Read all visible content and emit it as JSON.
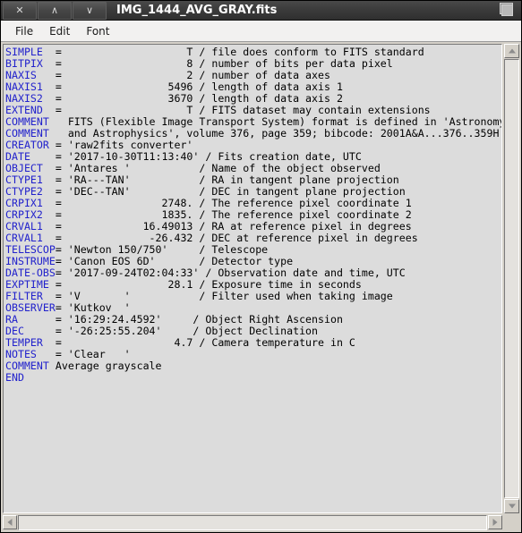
{
  "window": {
    "title": "IMG_1444_AVG_GRAY.fits",
    "buttons": {
      "close_label": "✕",
      "shade_up_label": "∧",
      "shade_down_label": "∨"
    },
    "maximize_icon": "maximize-icon"
  },
  "menubar": {
    "items": [
      {
        "label": "File"
      },
      {
        "label": "Edit"
      },
      {
        "label": "Font"
      }
    ]
  },
  "content": {
    "lines": [
      {
        "keyword": "SIMPLE",
        "rest": "  =                    T / file does conform to FITS standard"
      },
      {
        "keyword": "BITPIX",
        "rest": "  =                    8 / number of bits per data pixel"
      },
      {
        "keyword": "NAXIS",
        "rest": "   =                    2 / number of data axes"
      },
      {
        "keyword": "NAXIS1",
        "rest": "  =                 5496 / length of data axis 1"
      },
      {
        "keyword": "NAXIS2",
        "rest": "  =                 3670 / length of data axis 2"
      },
      {
        "keyword": "EXTEND",
        "rest": "  =                    T / FITS dataset may contain extensions"
      },
      {
        "keyword": "COMMENT",
        "rest": "   FITS (Flexible Image Transport System) format is defined in 'Astronomy"
      },
      {
        "keyword": "COMMENT",
        "rest": "   and Astrophysics', volume 376, page 359; bibcode: 2001A&A...376..359H"
      },
      {
        "keyword": "CREATOR",
        "rest": " = 'raw2fits converter'"
      },
      {
        "keyword": "DATE",
        "rest": "    = '2017-10-30T11:13:40' / Fits creation date, UTC"
      },
      {
        "keyword": "OBJECT",
        "rest": "  = 'Antares '           / Name of the object observed"
      },
      {
        "keyword": "CTYPE1",
        "rest": "  = 'RA---TAN'           / RA in tangent plane projection"
      },
      {
        "keyword": "CTYPE2",
        "rest": "  = 'DEC--TAN'           / DEC in tangent plane projection"
      },
      {
        "keyword": "CRPIX1",
        "rest": "  =                2748. / The reference pixel coordinate 1"
      },
      {
        "keyword": "CRPIX2",
        "rest": "  =                1835. / The reference pixel coordinate 2"
      },
      {
        "keyword": "CRVAL1",
        "rest": "  =             16.49013 / RA at reference pixel in degrees"
      },
      {
        "keyword": "CRVAL1",
        "rest": "  =              -26.432 / DEC at reference pixel in degrees"
      },
      {
        "keyword": "TELESCOP",
        "rest": "= 'Newton 150/750'     / Telescope"
      },
      {
        "keyword": "INSTRUME",
        "rest": "= 'Canon EOS 6D'       / Detector type"
      },
      {
        "keyword": "DATE-OBS",
        "rest": "= '2017-09-24T02:04:33' / Observation date and time, UTC"
      },
      {
        "keyword": "EXPTIME",
        "rest": " =                 28.1 / Exposure time in seconds"
      },
      {
        "keyword": "FILTER",
        "rest": "  = 'V       '           / Filter used when taking image"
      },
      {
        "keyword": "OBSERVER",
        "rest": "= 'Kutkov  '"
      },
      {
        "keyword": "RA",
        "rest": "      = '16:29:24.4592'     / Object Right Ascension"
      },
      {
        "keyword": "DEC",
        "rest": "     = '-26:25:55.204'     / Object Declination"
      },
      {
        "keyword": "TEMPER",
        "rest": "  =                  4.7 / Camera temperature in C"
      },
      {
        "keyword": "NOTES",
        "rest": "   = 'Clear   '"
      },
      {
        "keyword": "COMMENT",
        "rest": " Average grayscale"
      },
      {
        "keyword": "END",
        "rest": ""
      }
    ]
  },
  "scrollbars": {
    "vertical": {
      "up_icon": "scroll-up-arrow-icon",
      "down_icon": "scroll-down-arrow-icon"
    },
    "horizontal": {
      "left_icon": "scroll-left-arrow-icon",
      "right_icon": "scroll-right-arrow-icon"
    }
  },
  "colors": {
    "keyword": "#2222cc",
    "text": "#000000",
    "pane_background": "#dcdcdc",
    "window_background": "#d4d0c8",
    "titlebar": "#3a3a3a"
  }
}
